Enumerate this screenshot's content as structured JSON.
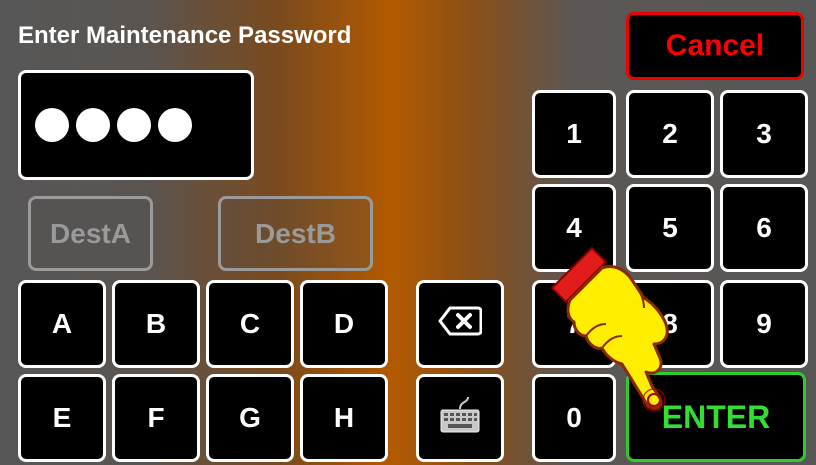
{
  "title": "Enter Maintenance Password",
  "password": {
    "masked_length": 4
  },
  "dest_buttons": [
    {
      "label": "DestA",
      "state": "disabled"
    },
    {
      "label": "DestB",
      "state": "disabled"
    }
  ],
  "letters_row1": [
    "A",
    "B",
    "C",
    "D"
  ],
  "letters_row2": [
    "E",
    "F",
    "G",
    "H"
  ],
  "numpad": [
    "1",
    "2",
    "3",
    "4",
    "5",
    "6",
    "7",
    "8",
    "9",
    "0"
  ],
  "cancel_label": "Cancel",
  "enter_label": "ENTER",
  "icons": {
    "backspace": "backspace-icon",
    "keyboard": "keyboard-icon",
    "pointer": "pointing-hand-icon"
  },
  "colors": {
    "cancel": "#ff0000",
    "enter": "#33dd33",
    "accent_center": "#b35a00"
  }
}
